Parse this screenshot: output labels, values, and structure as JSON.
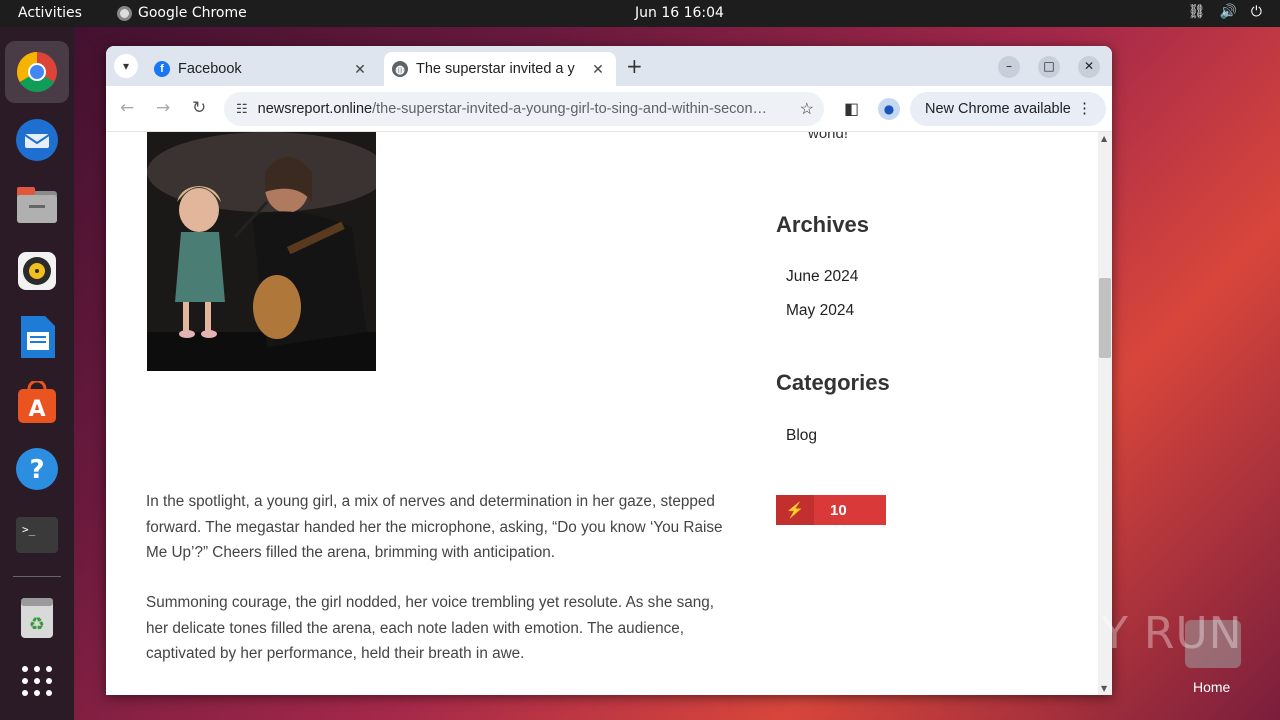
{
  "topbar": {
    "activities": "Activities",
    "app_name": "Google Chrome",
    "clock": "Jun 16  16:04"
  },
  "dock": {
    "items": [
      "Google Chrome",
      "Thunderbird Mail",
      "Files",
      "Rhythmbox",
      "LibreOffice Writer",
      "Ubuntu Software",
      "Help",
      "Terminal",
      "Trash",
      "Show Applications"
    ]
  },
  "browser": {
    "tabs": [
      {
        "title": "Facebook",
        "favicon": "facebook-icon"
      },
      {
        "title": "The superstar invited a y",
        "favicon": "globe-icon"
      }
    ],
    "url_host": "newsreport.online",
    "url_path": "/the-superstar-invited-a-young-girl-to-sing-and-within-second...",
    "update_label": "New Chrome available"
  },
  "page": {
    "sidebar_fragment": "world!",
    "archives_heading": "Archives",
    "archives": [
      "June 2024",
      "May 2024"
    ],
    "categories_heading": "Categories",
    "categories": [
      "Blog"
    ],
    "badge_count": "10",
    "paragraphs": [
      "In the spotlight, a young girl, a mix of nerves and determination in her gaze, stepped forward. The megastar handed her the microphone, asking, “Do you know ‘You Raise Me Up’?” Cheers filled the arena, brimming with anticipation.",
      "Summoning courage, the girl nodded, her voice trembling yet resolute. As she sang, her delicate tones filled the arena, each note laden with emotion. The audience, captivated by her performance, held their breath in awe."
    ]
  },
  "desktop": {
    "watermark": "ANY RUN",
    "home_label": "Home"
  }
}
